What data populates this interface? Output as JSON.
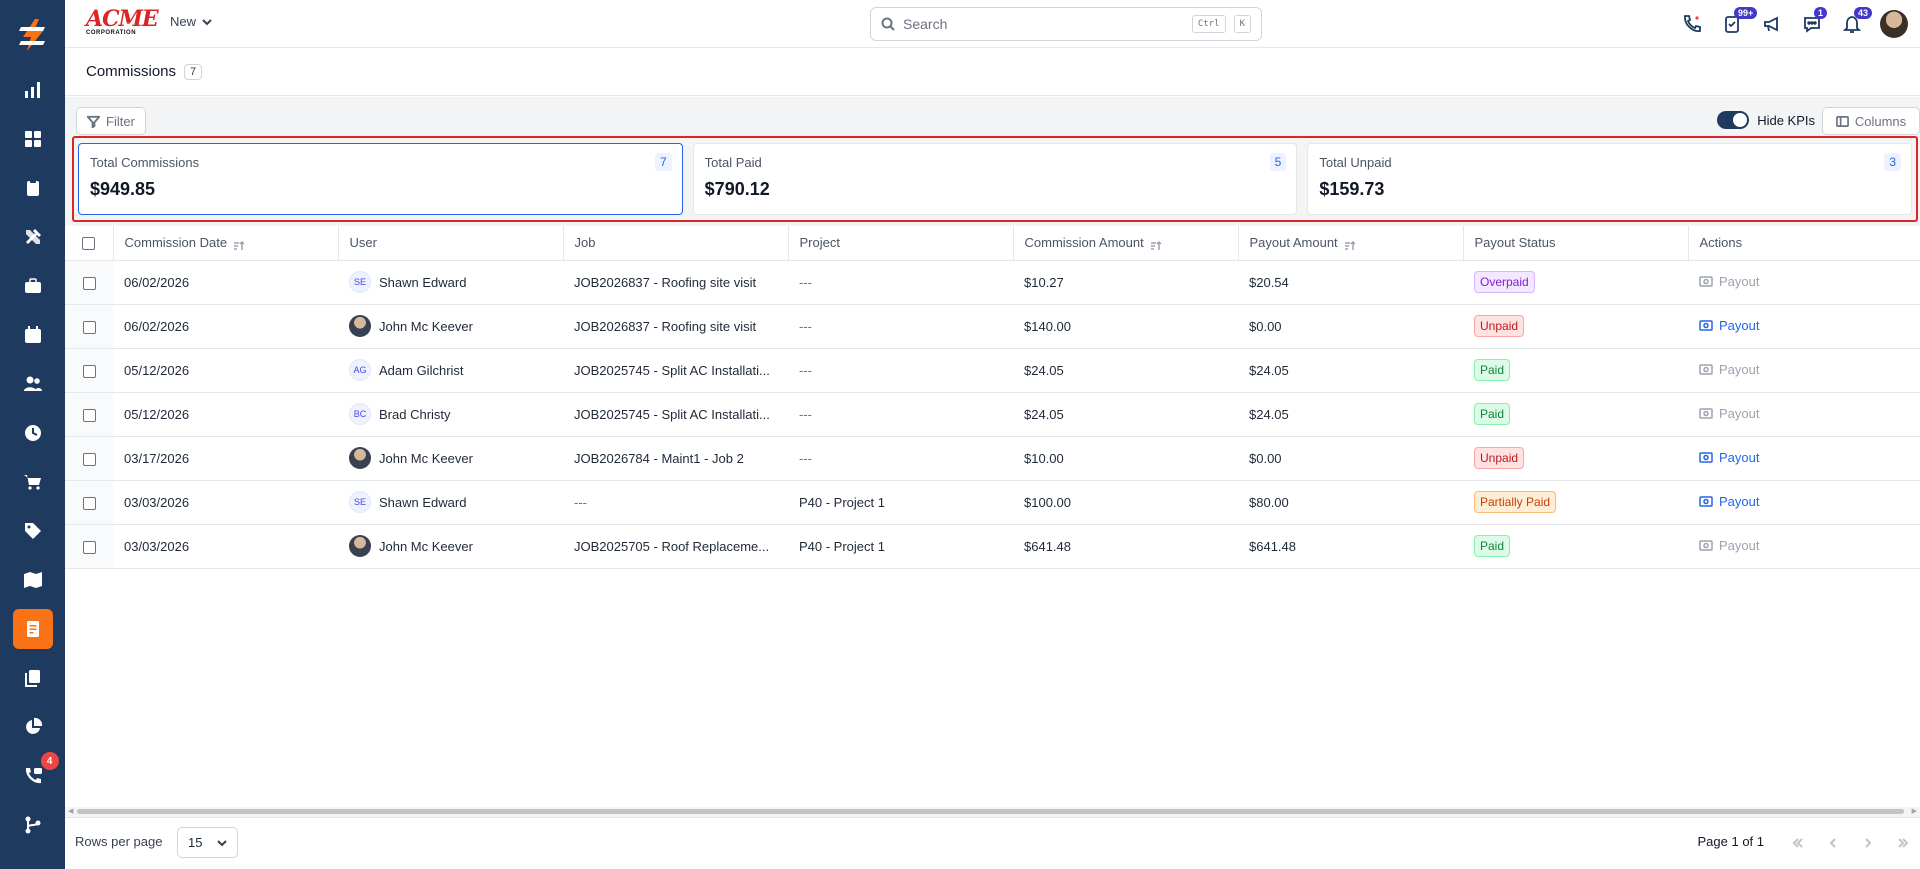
{
  "brand": {
    "name": "ACME",
    "sub": "CORPORATION"
  },
  "topbar": {
    "new_label": "New",
    "search_placeholder": "Search",
    "search_kbd_1": "Ctrl",
    "search_kbd_2": "K",
    "badges": {
      "tasks": "99+",
      "chat": "1",
      "notifications": "43"
    }
  },
  "sidebar": {
    "badge_calls": "4",
    "items": [
      "dashboard",
      "apps",
      "clipboard",
      "tools",
      "briefcase",
      "calendar",
      "users",
      "time",
      "cart",
      "tags",
      "map",
      "commissions",
      "documents",
      "reports",
      "calls",
      "workflow"
    ],
    "active": "commissions",
    "accent": "#f97316",
    "bg": "#1e3a5f"
  },
  "page": {
    "title": "Commissions",
    "count": "7"
  },
  "toolbar": {
    "filter": "Filter",
    "hide_kpis": "Hide KPIs",
    "columns": "Columns"
  },
  "kpis": [
    {
      "label": "Total Commissions",
      "value": "$949.85",
      "count": "7"
    },
    {
      "label": "Total Paid",
      "value": "$790.12",
      "count": "5"
    },
    {
      "label": "Total Unpaid",
      "value": "$159.73",
      "count": "3"
    }
  ],
  "table": {
    "headers": [
      "Commission Date",
      "User",
      "Job",
      "Project",
      "Commission Amount",
      "Payout Amount",
      "Payout Status",
      "Actions"
    ],
    "rows": [
      {
        "date": "06/02/2026",
        "user": "Shawn Edward",
        "initials": "SE",
        "job": "JOB2026837 - Roofing site visit",
        "project": "---",
        "commission": "$10.27",
        "payout": "$20.54",
        "status": "Overpaid",
        "action": "Payout"
      },
      {
        "date": "06/02/2026",
        "user": "John Mc Keever",
        "initials": "",
        "job": "JOB2026837 - Roofing site visit",
        "project": "---",
        "commission": "$140.00",
        "payout": "$0.00",
        "status": "Unpaid",
        "action": "Payout"
      },
      {
        "date": "05/12/2026",
        "user": "Adam Gilchrist",
        "initials": "AG",
        "job": "JOB2025745 - Split AC Installati...",
        "project": "---",
        "commission": "$24.05",
        "payout": "$24.05",
        "status": "Paid",
        "action": "Payout"
      },
      {
        "date": "05/12/2026",
        "user": "Brad Christy",
        "initials": "BC",
        "job": "JOB2025745 - Split AC Installati...",
        "project": "---",
        "commission": "$24.05",
        "payout": "$24.05",
        "status": "Paid",
        "action": "Payout"
      },
      {
        "date": "03/17/2026",
        "user": "John Mc Keever",
        "initials": "",
        "job": "JOB2026784 - Maint1 - Job 2",
        "project": "---",
        "commission": "$10.00",
        "payout": "$0.00",
        "status": "Unpaid",
        "action": "Payout"
      },
      {
        "date": "03/03/2026",
        "user": "Shawn Edward",
        "initials": "SE",
        "job": "---",
        "project": "P40 - Project 1",
        "commission": "$100.00",
        "payout": "$80.00",
        "status": "Partially Paid",
        "action": "Payout"
      },
      {
        "date": "03/03/2026",
        "user": "John Mc Keever",
        "initials": "",
        "job": "JOB2025705 - Roof Replaceme...",
        "project": "P40 - Project 1",
        "commission": "$641.48",
        "payout": "$641.48",
        "status": "Paid",
        "action": "Payout"
      }
    ]
  },
  "footer": {
    "rows_per_page_label": "Rows per page",
    "rows_per_page": "15",
    "page_info": "Page 1 of 1"
  }
}
